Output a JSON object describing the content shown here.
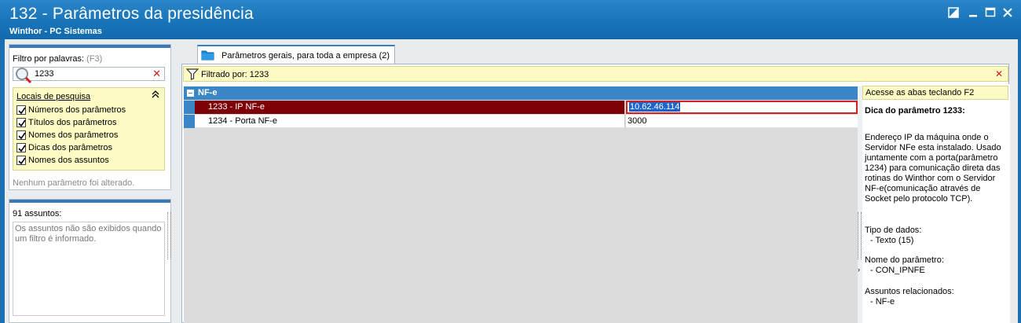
{
  "window": {
    "title": "132 - Parâmetros da presidência",
    "subtitle": "Winthor - PC Sistemas"
  },
  "left": {
    "filter_label": "Filtro por palavras:",
    "filter_shortcut": "(F3)",
    "search_value": "1233",
    "locais_title": "Locais de pesquisa",
    "locais": [
      {
        "label": "Números dos parâmetros",
        "checked": true
      },
      {
        "label": "Títulos dos parâmetros",
        "checked": true
      },
      {
        "label": "Nomes dos parâmetros",
        "checked": true
      },
      {
        "label": "Dicas dos parâmetros",
        "checked": true
      },
      {
        "label": "Nomes dos assuntos",
        "checked": true
      }
    ],
    "no_change": "Nenhum parâmetro foi alterado.",
    "assuntos_count": "91 assuntos:",
    "assuntos_note": "Os assuntos não são exibidos quando um filtro é informado."
  },
  "tab": {
    "label": "Parâmetros gerais, para toda a empresa",
    "count": "(2)"
  },
  "filterbar": {
    "text": "Filtrado por: 1233"
  },
  "grid": {
    "group": "NF-e",
    "rows": [
      {
        "name": "1233 - IP NF-e",
        "value": "10.62.46.114",
        "selected": true
      },
      {
        "name": "1234 - Porta NF-e",
        "value": "3000",
        "selected": false
      }
    ]
  },
  "help": {
    "tip": "Acesse as abas teclando F2",
    "title": "Dica do parâmetro 1233:",
    "description": "Endereço IP da máquina onde o Servidor NFe esta instalado. Usado juntamente com a porta(parâmetro 1234) para comunicação direta das rotinas do Winthor com o Servidor NF-e(comunicação através de Socket pelo protocolo TCP).",
    "tipo_label": "Tipo de dados:",
    "tipo_value": "- Texto (15)",
    "nome_label": "Nome do parâmetro:",
    "nome_value": "- CON_IPNFE",
    "assuntos_label": "Assuntos relacionados:",
    "assuntos_value": "- NF-e"
  },
  "colors": {
    "titlebar": "#1873b8",
    "selected_row": "#7d0006",
    "group_row": "#3a86c6",
    "info_yellow": "#fdfbc4"
  }
}
